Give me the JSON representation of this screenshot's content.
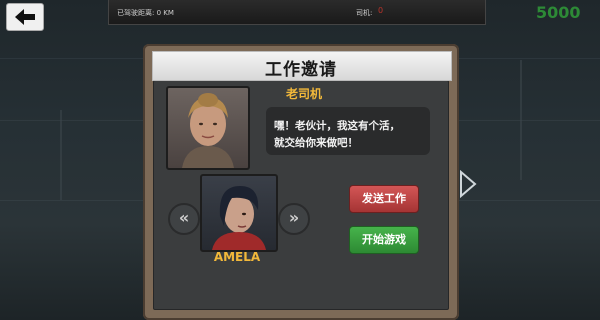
{
  "hud": {
    "distance_label": "已驾驶距离: 0 KM",
    "driver_label": "司机:",
    "driver_value": "0",
    "money": "5000"
  },
  "dialog": {
    "title": "工作邀请",
    "boss_name": "老司机",
    "message_line1": "嘿！老伙计，我这有个活，",
    "message_line2": "就交给你来做吧！",
    "driver_name": "AMELA",
    "prev_label": "«",
    "next_label": "»",
    "send_button": "发送工作",
    "start_button": "开始游戏"
  },
  "colors": {
    "money": "#2d8a36",
    "name_accent": "#f2b83a",
    "send_button": "#c04545",
    "start_button": "#3aa240"
  }
}
